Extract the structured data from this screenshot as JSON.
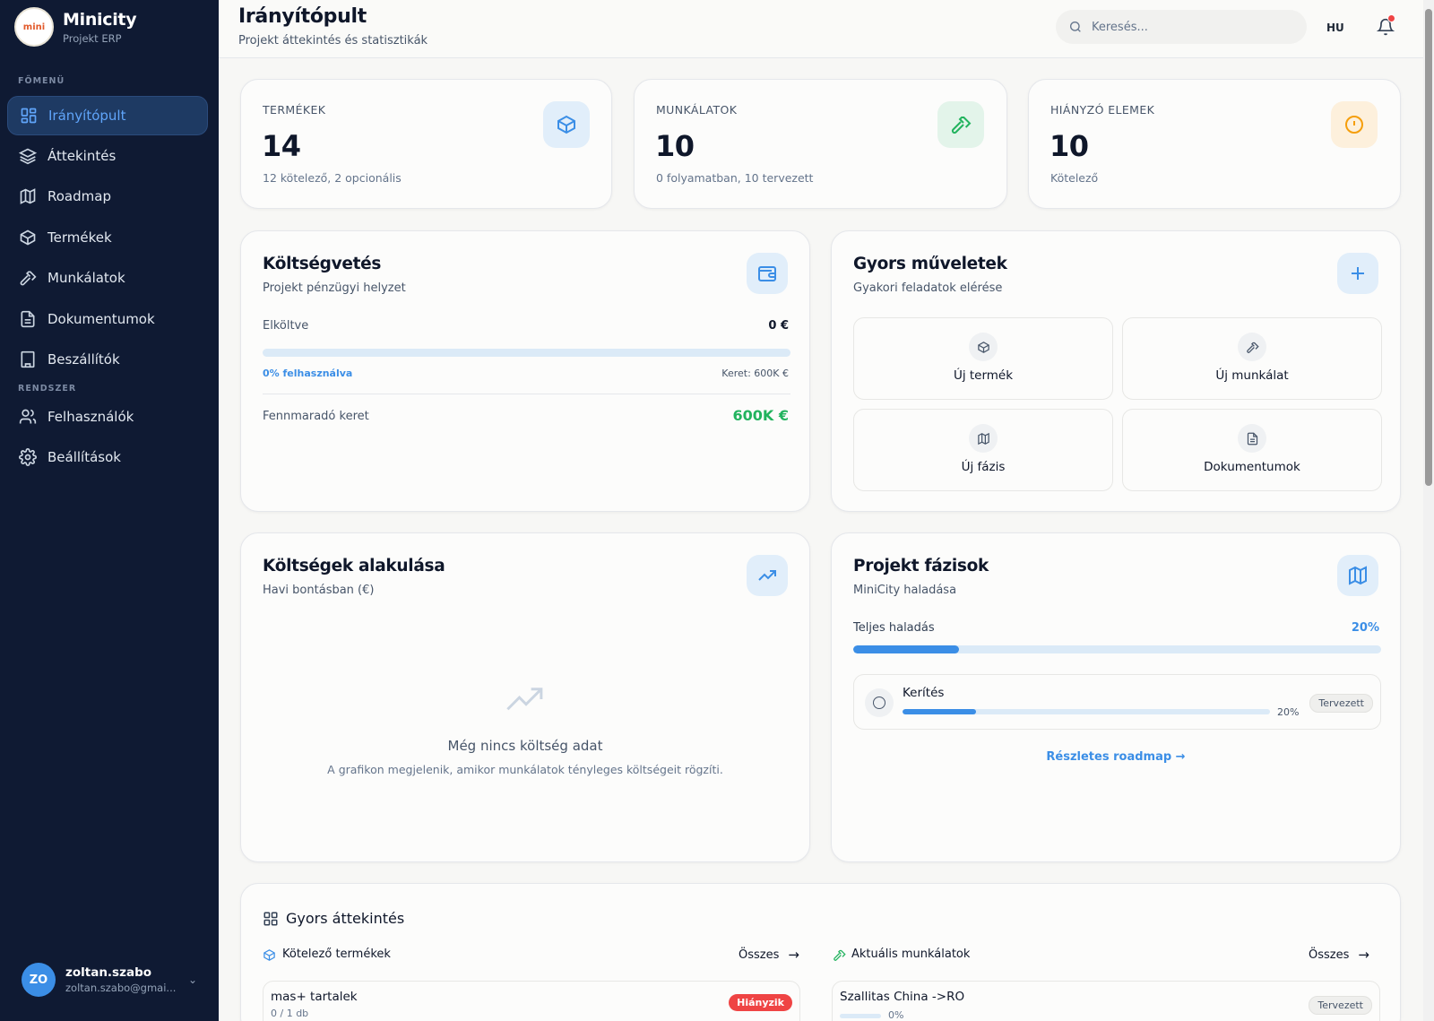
{
  "brand": {
    "title": "Minicity",
    "subtitle": "Projekt ERP",
    "logo_text": "mini"
  },
  "sidebar": {
    "section_main": "FŐMENÜ",
    "section_system": "RENDSZER",
    "items": [
      {
        "label": "Irányítópult",
        "icon": "dashboard-icon",
        "active": true
      },
      {
        "label": "Áttekintés",
        "icon": "layers-icon"
      },
      {
        "label": "Roadmap",
        "icon": "map-icon"
      },
      {
        "label": "Termékek",
        "icon": "package-icon"
      },
      {
        "label": "Munkálatok",
        "icon": "hammer-icon"
      },
      {
        "label": "Dokumentumok",
        "icon": "document-icon"
      },
      {
        "label": "Beszállítók",
        "icon": "building-icon"
      }
    ],
    "system_items": [
      {
        "label": "Felhasználók",
        "icon": "users-icon"
      },
      {
        "label": "Beállítások",
        "icon": "gear-icon"
      }
    ]
  },
  "user": {
    "initials": "ZO",
    "name": "zoltan.szabo",
    "email": "zoltan.szabo@gmai..."
  },
  "header": {
    "title": "Irányítópult",
    "subtitle": "Projekt áttekintés és statisztikák",
    "search_placeholder": "Keresés...",
    "lang": "HU"
  },
  "stats": [
    {
      "label": "TERMÉKEK",
      "value": "14",
      "note": "12 kötelező, 2 opcionális",
      "icon": "package-icon"
    },
    {
      "label": "MUNKÁLATOK",
      "value": "10",
      "note": "0 folyamatban, 10 tervezett",
      "icon": "hammer-icon"
    },
    {
      "label": "HIÁNYZÓ ELEMEK",
      "value": "10",
      "note": "Kötelező",
      "icon": "alert-circle-icon"
    }
  ],
  "budget": {
    "title": "Költségvetés",
    "subtitle": "Projekt pénzügyi helyzet",
    "spent_label": "Elköltve",
    "spent_value": "0 €",
    "used_label": "0% felhasználva",
    "used_fraction": 0,
    "limit_label": "Keret: 600K €",
    "remaining_label": "Fennmaradó keret",
    "remaining_value": "600K €"
  },
  "quick_actions": {
    "title": "Gyors műveletek",
    "subtitle": "Gyakori feladatok elérése",
    "items": [
      {
        "label": "Új termék",
        "icon": "package-icon"
      },
      {
        "label": "Új munkálat",
        "icon": "hammer-icon"
      },
      {
        "label": "Új fázis",
        "icon": "map-icon"
      },
      {
        "label": "Dokumentumok",
        "icon": "document-icon"
      }
    ]
  },
  "costs": {
    "title": "Költségek alakulása",
    "subtitle": "Havi bontásban (€)",
    "empty_title": "Még nincs költség adat",
    "empty_text": "A grafikon megjelenik, amikor munkálatok tényleges költségeit rögzíti."
  },
  "phases": {
    "title": "Projekt fázisok",
    "subtitle": "MiniCity haladása",
    "total_label": "Teljes haladás",
    "total_percent": "20%",
    "total_fraction": 0.2,
    "items": [
      {
        "name": "Kerítés",
        "percent": "20%",
        "fraction": 0.2,
        "status": "Tervezett"
      }
    ],
    "link": "Részletes roadmap →"
  },
  "overview": {
    "title": "Gyors áttekintés",
    "left": {
      "title": "Kötelező termékek",
      "all_label": "Összes",
      "items": [
        {
          "name": "mas+ tartalek",
          "detail": "0 / 1 db",
          "badge": "Hiányzik"
        }
      ]
    },
    "right": {
      "title": "Aktuális munkálatok",
      "all_label": "Összes",
      "items": [
        {
          "name": "Szallitas China ->RO",
          "percent": "0%",
          "fraction": 0,
          "badge": "Tervezett"
        }
      ]
    }
  },
  "colors": {
    "accent": "#3b8ee6",
    "sidebar": "#0f1a33",
    "success": "#22b35e",
    "danger": "#ef4444",
    "warning": "#f59e0b"
  }
}
